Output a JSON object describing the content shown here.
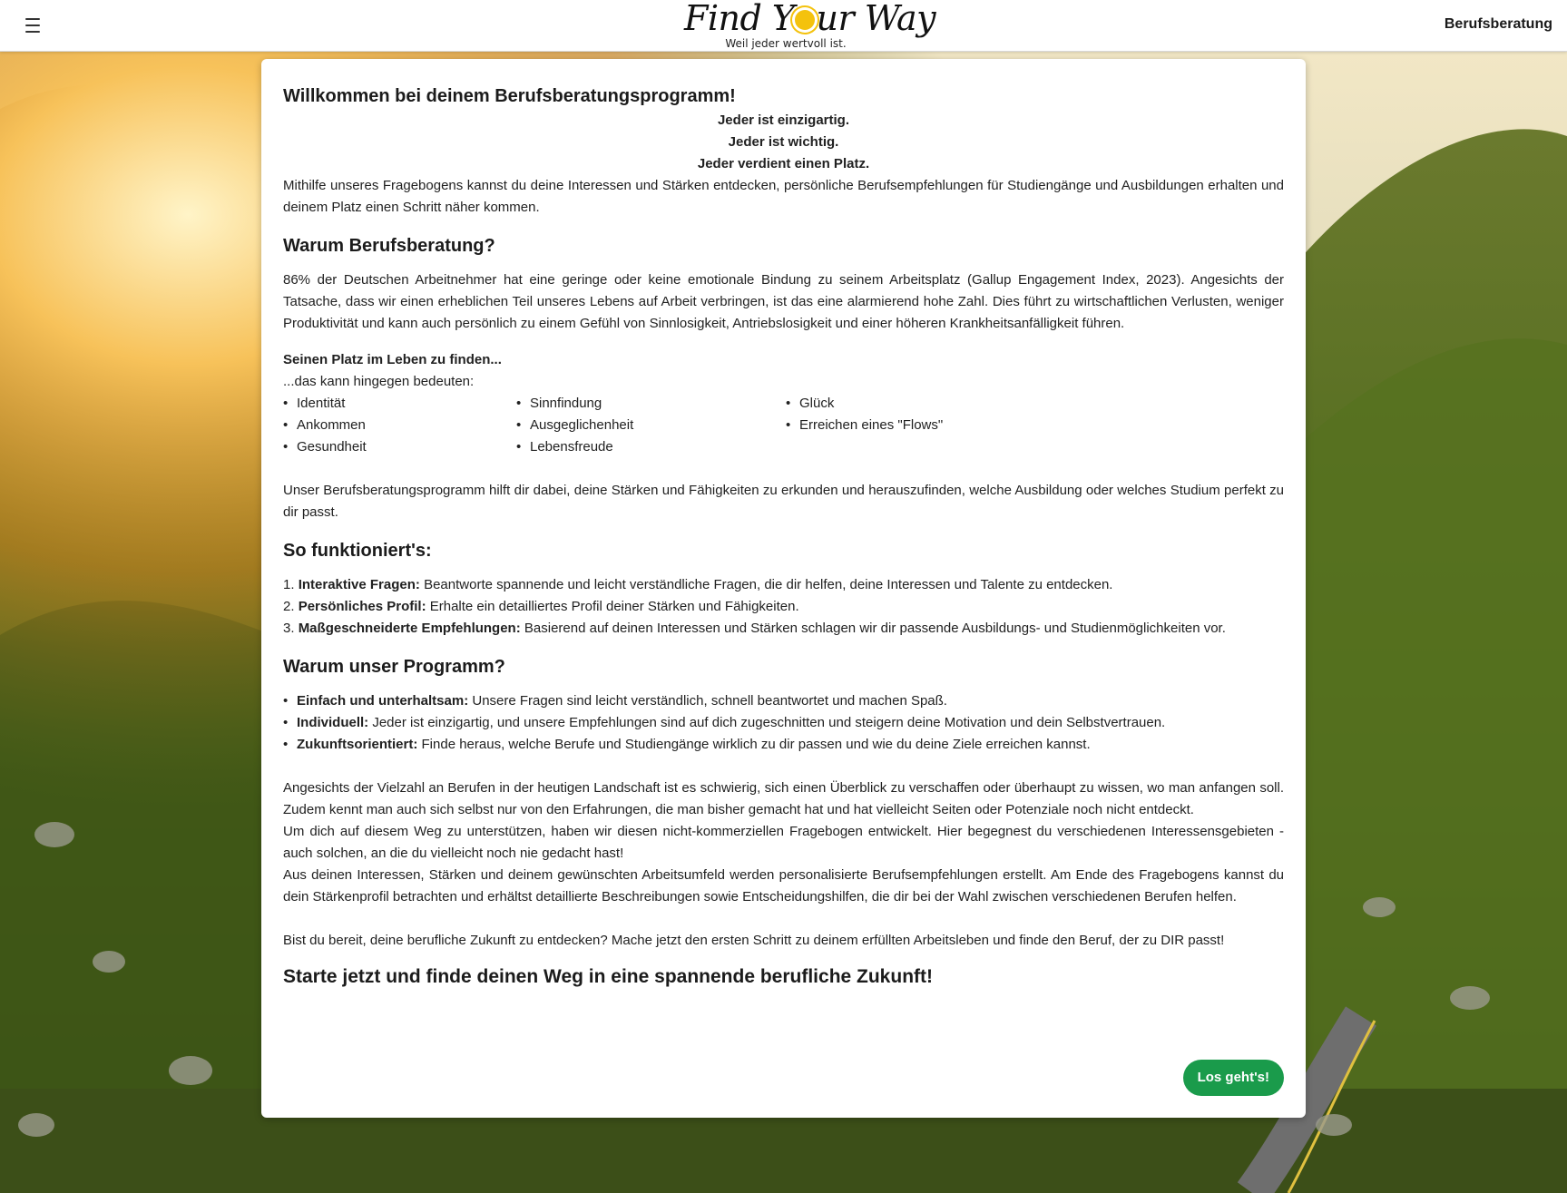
{
  "header": {
    "menu_icon": "hamburger-menu-icon",
    "logo_title_part1": "Find Y",
    "logo_title_part2": "ur Way",
    "logo_tagline": "Weil jeder wertvoll ist.",
    "nav_link": "Berufsberatung"
  },
  "intro": {
    "title": "Willkommen bei deinem Berufsberatungsprogramm!",
    "motto": [
      "Jeder ist einzigartig.",
      "Jeder ist wichtig.",
      "Jeder verdient einen Platz."
    ],
    "text": "Mithilfe unseres Fragebogens kannst du deine Interessen und Stärken entdecken, persönliche Berufsempfehlungen für Studiengänge und Ausbildungen erhalten und deinem Platz einen Schritt näher kommen."
  },
  "why": {
    "heading": "Warum Berufsberatung?",
    "text": "86% der Deutschen Arbeitnehmer hat eine geringe oder keine emotionale Bindung zu seinem Arbeitsplatz (Gallup Engagement Index, 2023). Angesichts der Tatsache, dass wir einen erheblichen Teil unseres Lebens auf Arbeit verbringen, ist das eine alarmierend hohe Zahl. Dies führt zu wirtschaftlichen Verlusten, weniger Produktivität und kann auch persönlich zu einem Gefühl von Sinnlosigkeit, Antriebslosigkeit und einer höheren Krankheitsanfälligkeit führen.",
    "place_heading": "Seinen Platz im Leben zu finden...",
    "place_sub": "...das kann hingegen bedeuten:",
    "columns": [
      [
        "Identität",
        "Ankommen",
        "Gesundheit"
      ],
      [
        "Sinnfindung",
        "Ausgeglichenheit",
        "Lebensfreude"
      ],
      [
        "Glück",
        "Erreichen eines \"Flows\""
      ]
    ],
    "closing": "Unser Berufsberatungsprogramm hilft dir dabei, deine Stärken und Fähigkeiten zu erkunden und herauszufinden, welche Ausbildung oder welches Studium perfekt zu dir passt."
  },
  "how": {
    "heading": "So funktioniert's:",
    "steps": [
      {
        "num": "1.",
        "label": "Interaktive Fragen:",
        "text": " Beantworte spannende und leicht verständliche Fragen, die dir helfen, deine Interessen und Talente zu entdecken."
      },
      {
        "num": "2.",
        "label": "Persönliches Profil:",
        "text": " Erhalte ein detailliertes Profil deiner Stärken und Fähigkeiten."
      },
      {
        "num": "3.",
        "label": "Maßgeschneiderte Empfehlungen:",
        "text": " Basierend auf deinen Interessen und Stärken schlagen wir dir passende Ausbildungs- und Studienmöglichkeiten vor."
      }
    ]
  },
  "program": {
    "heading": "Warum unser Programm?",
    "points": [
      {
        "label": "Einfach und unterhaltsam:",
        "text": " Unsere Fragen sind leicht verständlich, schnell beantwortet und machen Spaß."
      },
      {
        "label": "Individuell:",
        "text": " Jeder ist einzigartig, und unsere Empfehlungen sind auf dich zugeschnitten und steigern deine Motivation und dein Selbstvertrauen."
      },
      {
        "label": "Zukunftsorientiert:",
        "text": " Finde heraus, welche Berufe und Studiengänge wirklich zu dir passen und wie du deine Ziele erreichen kannst."
      }
    ],
    "para1": "Angesichts der Vielzahl an Berufen in der heutigen Landschaft ist es schwierig, sich einen Überblick zu verschaffen oder überhaupt zu wissen, wo man anfangen soll. Zudem kennt man auch sich selbst nur von den Erfahrungen, die man bisher gemacht hat und hat vielleicht Seiten oder Potenziale noch nicht entdeckt.",
    "para2": "Um dich auf diesem Weg zu unterstützen, haben wir diesen nicht-kommerziellen Fragebogen entwickelt. Hier begegnest du verschiedenen Interessensgebieten - auch solchen, an die du vielleicht noch nie gedacht hast!",
    "para3": "Aus deinen Interessen, Stärken und deinem gewünschten Arbeitsumfeld werden personalisierte Berufsempfehlungen erstellt. Am Ende des Fragebogens kannst du dein Stärkenprofil betrachten und erhältst detaillierte Beschreibungen sowie Entscheidungshilfen, die dir bei der Wahl zwischen verschiedenen Berufen helfen.",
    "para4": "Bist du bereit, deine berufliche Zukunft zu entdecken? Mache jetzt den ersten Schritt zu deinem erfüllten Arbeitsleben und finde den Beruf, der zu DIR passt!"
  },
  "cta": {
    "heading": "Starte jetzt und finde deinen Weg in eine spannende berufliche Zukunft!",
    "button": "Los geht's!",
    "button_color": "#1a9b4b"
  }
}
